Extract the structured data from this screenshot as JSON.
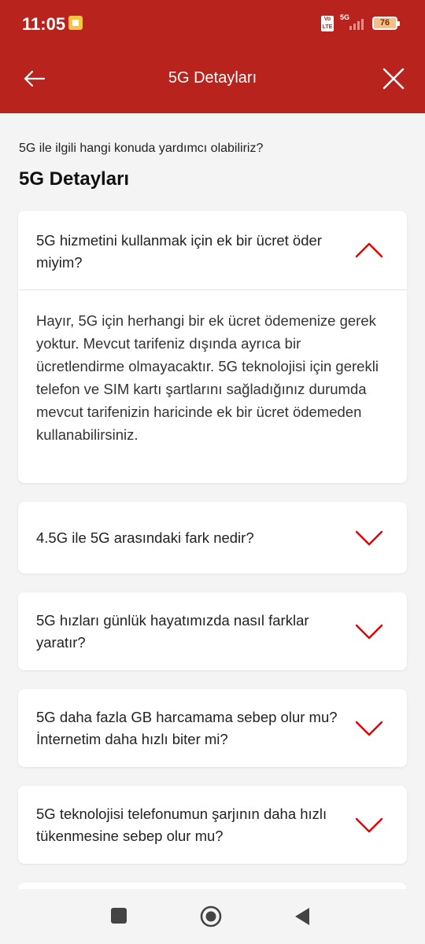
{
  "status_bar": {
    "time": "11:05",
    "volte": "Vo LTE",
    "network": "5G",
    "battery": "76"
  },
  "app_bar": {
    "title": "5G Detayları",
    "back_icon": "arrow-left-icon",
    "close_icon": "close-icon"
  },
  "intro_text": "5G ile ilgili hangi konuda yardımcı olabiliriz?",
  "heading": "5G Detayları",
  "faq": [
    {
      "question": "5G hizmetini kullanmak için ek bir ücret öder miyim?",
      "expanded": true,
      "answer": "Hayır, 5G için herhangi bir ek ücret ödemenize gerek yoktur. Mevcut tarifeniz dışında ayrıca bir ücretlendirme olmayacaktır. 5G teknolojisi için gerekli telefon ve SIM kartı şartlarını sağladığınız durumda mevcut tarifenizin haricinde ek bir ücret ödemeden kullanabilirsiniz."
    },
    {
      "question": "4.5G ile 5G arasındaki fark nedir?",
      "expanded": false
    },
    {
      "question": "5G hızları günlük hayatımızda nasıl farklar yaratır?",
      "expanded": false
    },
    {
      "question": "5G daha fazla GB harcamama sebep olur mu? İnternetim daha hızlı biter mi?",
      "expanded": false
    },
    {
      "question": "5G teknolojisi telefonumun şarjının daha hızlı tükenmesine sebep olur mu?",
      "expanded": false
    }
  ],
  "colors": {
    "brand_red": "#b8231e",
    "chevron_red": "#e60000",
    "background": "#f4f4f4"
  }
}
